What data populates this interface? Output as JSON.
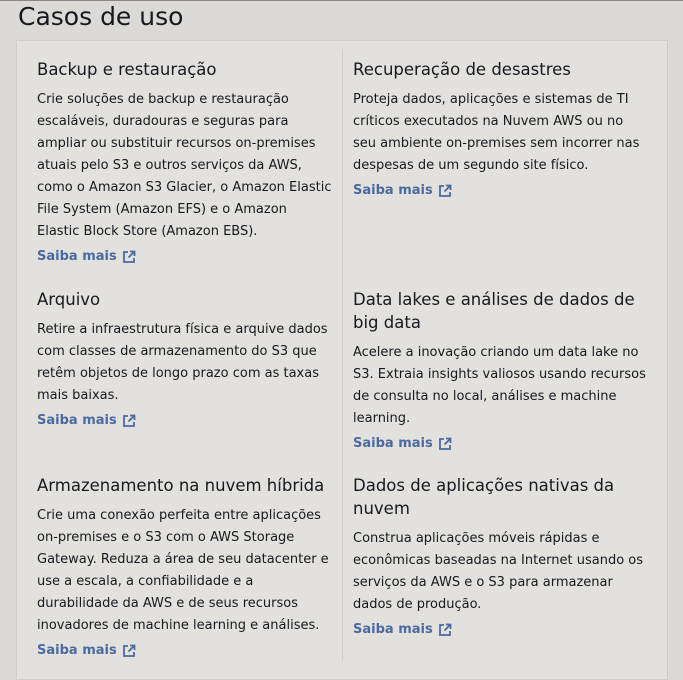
{
  "section": {
    "title": "Casos de uso"
  },
  "link_icon": "external-link-icon",
  "colors": {
    "link": "#4b6aa0",
    "background": "#dcdad6",
    "panel": "#e3e1dd",
    "text": "#16191f"
  },
  "cards": [
    {
      "title": "Backup e restauração",
      "body": "Crie soluções de backup e restauração escaláveis, duradouras e seguras para ampliar ou substituir recursos on-premises atuais pelo S3 e outros serviços da AWS, como o Amazon S3 Glacier, o Amazon Elastic File System (Amazon EFS) e o Amazon Elastic Block Store (Amazon EBS).",
      "link": "Saiba mais"
    },
    {
      "title": "Recuperação de desastres",
      "body": "Proteja dados, aplicações e sistemas de TI críticos executados na Nuvem AWS ou no seu ambiente on-premises sem incorrer nas despesas de um segundo site físico.",
      "link": "Saiba mais"
    },
    {
      "title": "Arquivo",
      "body": "Retire a infraestrutura física e arquive dados com classes de armazenamento do S3 que retêm objetos de longo prazo com as taxas mais baixas.",
      "link": "Saiba mais"
    },
    {
      "title": "Data lakes e análises de dados de big data",
      "body": "Acelere a inovação criando um data lake no S3. Extraia insights valiosos usando recursos de consulta no local, análises e machine learning.",
      "link": "Saiba mais"
    },
    {
      "title": "Armazenamento na nuvem híbrida",
      "body": "Crie uma conexão perfeita entre aplicações on-premises e o S3 com o AWS Storage Gateway. Reduza a área de seu datacenter e use a escala, a confiabilidade e a durabilidade da AWS e de seus recursos inovadores de machine learning e análises.",
      "link": "Saiba mais"
    },
    {
      "title": "Dados de aplicações nativas da nuvem",
      "body": "Construa aplicações móveis rápidas e econômicas baseadas na Internet usando os serviços da AWS e o S3 para armazenar dados de produção.",
      "link": "Saiba mais"
    }
  ]
}
